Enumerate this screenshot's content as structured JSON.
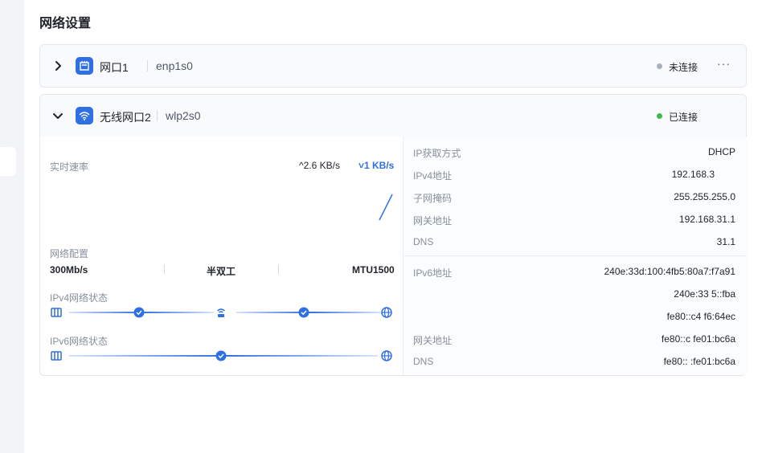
{
  "page": {
    "title": "网络设置"
  },
  "interfaces": [
    {
      "name": "网口1",
      "device": "enp1s0",
      "status": "未连接",
      "status_color": "#a7b0bc",
      "more": "···"
    },
    {
      "name": "无线网口2",
      "device": "wlp2s0",
      "status": "已连接",
      "status_color": "#3fb950",
      "speed": {
        "label": "实时速率",
        "up": "^2.6 KB/s",
        "down": "˅1 KB/s"
      },
      "config": {
        "label": "网络配置",
        "bandwidth": "300Mb/s",
        "duplex": "半双工",
        "mtu": "MTU1500"
      },
      "ipv4_status": {
        "label": "IPv4网络状态"
      },
      "ipv6_status": {
        "label": "IPv6网络状态"
      },
      "ipv4": [
        {
          "label": "IP获取方式",
          "value": "DHCP"
        },
        {
          "label": "IPv4地址",
          "value": "192.168.3"
        },
        {
          "label": "子网掩码",
          "value": "255.255.255.0"
        },
        {
          "label": "网关地址",
          "value": "192.168.31.1"
        },
        {
          "label": "DNS",
          "value": "31.1"
        }
      ],
      "ipv6": {
        "label": "IPv6地址",
        "values": [
          "240e:33d:100:4fb5:80a7:f7a91",
          "240e:33 5::fba",
          "fe80::c4 f6:64ec"
        ],
        "gateway_label": "网关地址",
        "gateway": "fe80::c fe01:bc6a",
        "dns_label": "DNS",
        "dns": "fe80:: :fe01:bc6a"
      }
    }
  ],
  "colors": {
    "accent": "#2f6fe4",
    "connected": "#3fb950",
    "disconnected": "#a7b0bc"
  }
}
